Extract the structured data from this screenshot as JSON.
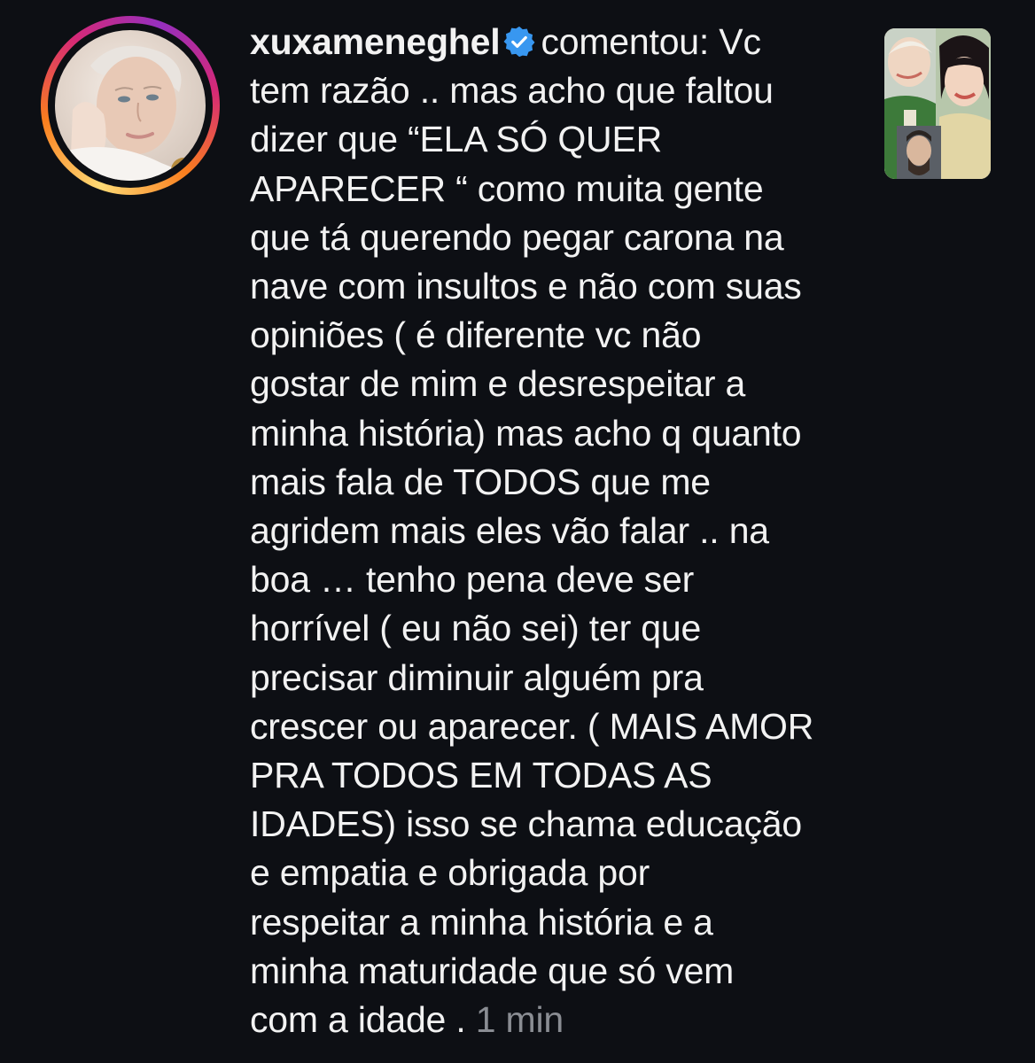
{
  "notification": {
    "username": "xuxameneghel",
    "action": "comentou: ",
    "lines": [
      "Vc",
      "tem razão .. mas acho que faltou",
      "dizer que “ELA SÓ QUER",
      "APARECER “ como muita gente",
      "que tá querendo pegar carona na",
      "nave com insultos e não com suas",
      "opiniões ( é diferente vc não",
      "gostar de mim e desrespeitar a",
      "minha história) mas acho q quanto",
      "mais fala de TODOS que me",
      "agridem mais eles vão falar .. na",
      "boa … tenho pena deve ser",
      "horrível ( eu não sei) ter que",
      "precisar diminuir alguém pra",
      "crescer ou aparecer. ( MAIS AMOR",
      "PRA TODOS EM TODAS AS",
      "IDADES) isso se chama educação",
      "e empatia  e obrigada por",
      "respeitar a minha história e a",
      "minha maturidade que só vem",
      "com a idade . "
    ],
    "timestamp": "1 min",
    "icons": {
      "verified": "verified-badge-icon",
      "avatar": "profile-avatar",
      "thumbnail": "post-thumbnail"
    },
    "colors": {
      "background": "#0d0f14",
      "text": "#f2f2f2",
      "timestamp": "#8a8d93",
      "verified": "#3897f0"
    }
  }
}
